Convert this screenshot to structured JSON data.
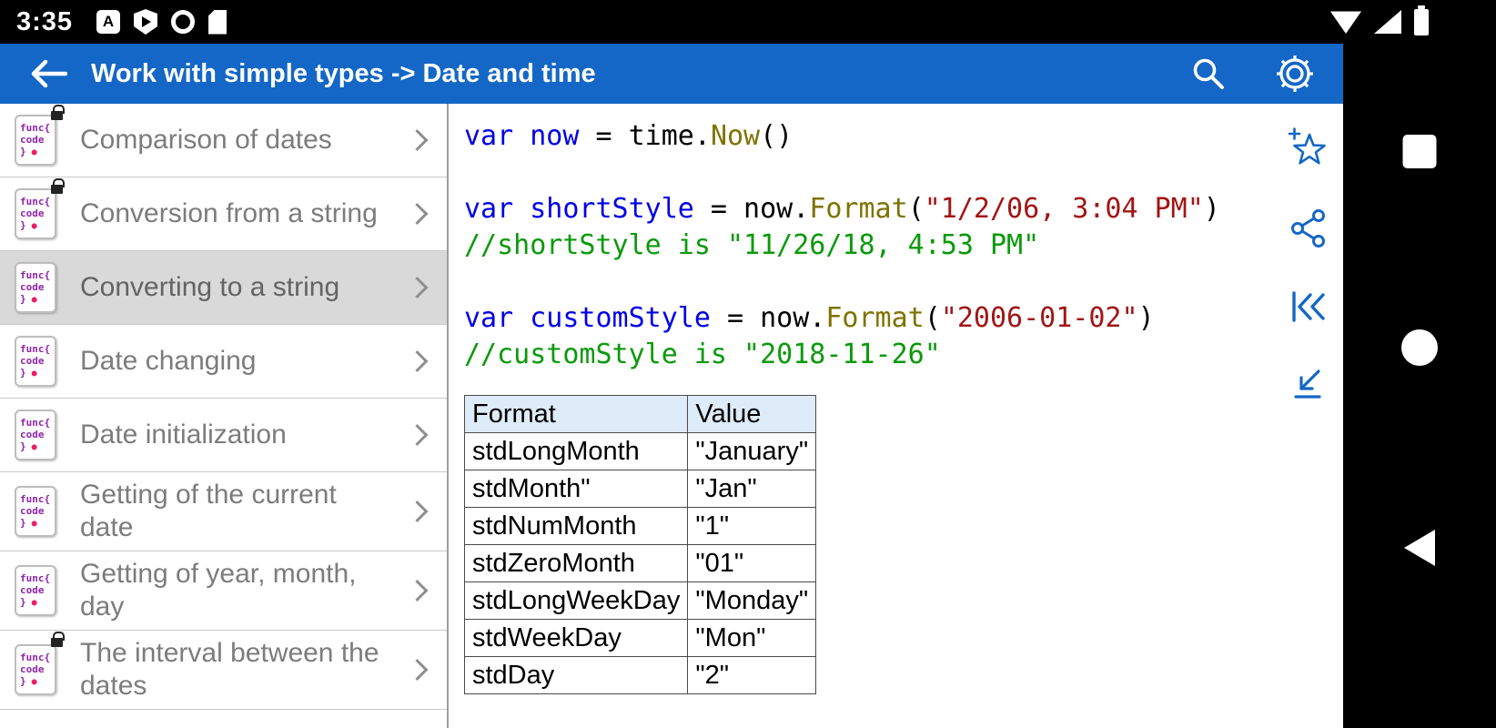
{
  "status_bar": {
    "time": "3:35"
  },
  "app_bar": {
    "title": "Work with simple types -> Date and time"
  },
  "icons": {
    "app_bar": [
      "back-arrow-icon",
      "search-icon",
      "gear-icon"
    ],
    "status_left": [
      "translate-app-icon",
      "play-protect-icon",
      "spiral-app-icon",
      "sim-card-icon"
    ],
    "status_right": [
      "wifi-icon",
      "signal-icon",
      "battery-icon"
    ],
    "actions": [
      "favorite-star-plus-icon",
      "share-icon",
      "skip-to-start-icon",
      "jump-bottom-left-icon"
    ],
    "nav": [
      "recents-square",
      "home-circle",
      "back-triangle"
    ]
  },
  "sidebar": {
    "items": [
      {
        "label": "Comparison of dates",
        "locked": true,
        "selected": false
      },
      {
        "label": "Conversion from a string",
        "locked": true,
        "selected": false
      },
      {
        "label": "Converting to a string",
        "locked": false,
        "selected": true
      },
      {
        "label": "Date changing",
        "locked": false,
        "selected": false
      },
      {
        "label": "Date initialization",
        "locked": false,
        "selected": false
      },
      {
        "label": "Getting of the current date",
        "locked": false,
        "selected": false
      },
      {
        "label": "Getting of year, month, day",
        "locked": false,
        "selected": false
      },
      {
        "label": "The interval between the dates",
        "locked": true,
        "selected": false
      }
    ],
    "badge_lines": [
      "func{",
      "code",
      "}"
    ],
    "badge_dot": "●"
  },
  "code": {
    "token_colors": {
      "kw": "#0000E6",
      "name": "#0000E6",
      "fn": "#7E7300",
      "str": "#A31515",
      "comment": "#0A9A0A",
      "plain": "#000000"
    },
    "lines": [
      [
        {
          "t": "var",
          "c": "kw"
        },
        {
          "t": " ",
          "c": "plain"
        },
        {
          "t": "now",
          "c": "name"
        },
        {
          "t": " = time.",
          "c": "plain"
        },
        {
          "t": "Now",
          "c": "fn"
        },
        {
          "t": "()",
          "c": "plain"
        }
      ],
      [],
      [
        {
          "t": "var",
          "c": "kw"
        },
        {
          "t": " ",
          "c": "plain"
        },
        {
          "t": "shortStyle",
          "c": "name"
        },
        {
          "t": " = now.",
          "c": "plain"
        },
        {
          "t": "Format",
          "c": "fn"
        },
        {
          "t": "(",
          "c": "plain"
        },
        {
          "t": "\"1/2/06, 3:04 PM\"",
          "c": "str"
        },
        {
          "t": ")",
          "c": "plain"
        }
      ],
      [
        {
          "t": "//shortStyle is \"11/26/18, 4:53 PM\"",
          "c": "comment"
        }
      ],
      [],
      [
        {
          "t": "var",
          "c": "kw"
        },
        {
          "t": " ",
          "c": "plain"
        },
        {
          "t": "customStyle",
          "c": "name"
        },
        {
          "t": " = now.",
          "c": "plain"
        },
        {
          "t": "Format",
          "c": "fn"
        },
        {
          "t": "(",
          "c": "plain"
        },
        {
          "t": "\"2006-01-02\"",
          "c": "str"
        },
        {
          "t": ")",
          "c": "plain"
        }
      ],
      [
        {
          "t": "//customStyle is \"2018-11-26\"",
          "c": "comment"
        }
      ]
    ]
  },
  "format_table": {
    "headers": [
      "Format",
      "Value"
    ],
    "rows": [
      [
        "stdLongMonth",
        "\"January\""
      ],
      [
        "stdMonth\"",
        "\"Jan\""
      ],
      [
        "stdNumMonth",
        "\"1\""
      ],
      [
        "stdZeroMonth",
        "\"01\""
      ],
      [
        "stdLongWeekDay",
        "\"Monday\""
      ],
      [
        "stdWeekDay",
        "\"Mon\""
      ],
      [
        "stdDay",
        "\"2\""
      ]
    ]
  },
  "colors": {
    "app_bar": "#1467C6",
    "accent": "#1467C6",
    "selected_bg": "#D9D9D9",
    "table_header_bg": "#DEEBF9"
  }
}
